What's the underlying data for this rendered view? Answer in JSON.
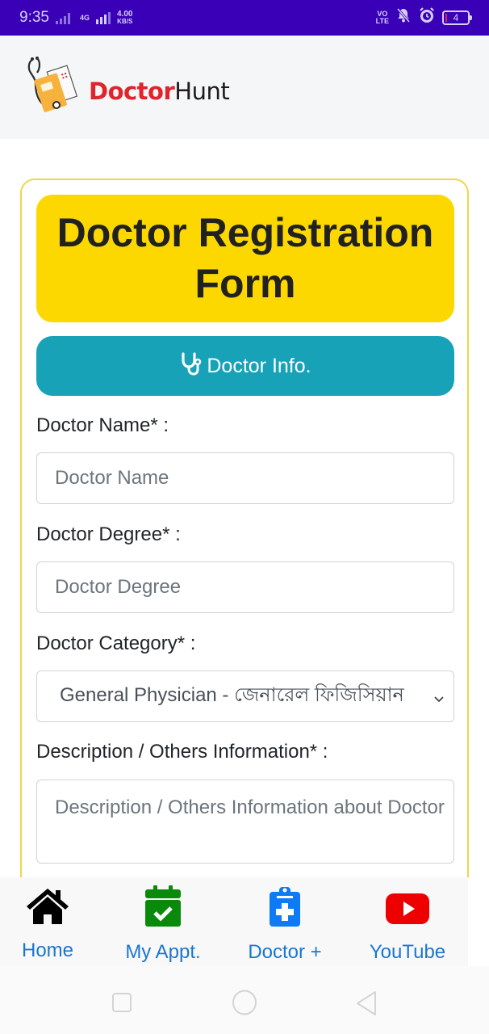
{
  "status_bar": {
    "time": "9:35",
    "network_type": "4G",
    "data_speed_value": "4.00",
    "data_speed_unit": "KB/S",
    "volte_top": "VO",
    "volte_bottom": "LTE",
    "battery_level": "4"
  },
  "header": {
    "brand_part1": "Doctor",
    "brand_part2": "Hunt"
  },
  "form": {
    "title": "Doctor Registration Form",
    "section_button": "Doctor Info.",
    "fields": [
      {
        "label": "Doctor Name* :",
        "placeholder": "Doctor Name"
      },
      {
        "label": "Doctor Degree* :",
        "placeholder": "Doctor Degree"
      },
      {
        "label": "Doctor Category* :",
        "selected": "General Physician - জেনারেল ফিজিসিয়ান"
      },
      {
        "label": "Description / Others Information* :",
        "placeholder": "Description / Others Information about Doctor"
      }
    ]
  },
  "bottom_nav": [
    {
      "label": "Home",
      "icon": "home-icon",
      "color": "#000000"
    },
    {
      "label": "My Appt.",
      "icon": "calendar-check-icon",
      "color": "#0a8a0a"
    },
    {
      "label": "Doctor +",
      "icon": "clipboard-medical-icon",
      "color": "#0d7bf5"
    },
    {
      "label": "YouTube",
      "icon": "youtube-icon",
      "color": "#ee0000"
    }
  ],
  "colors": {
    "status_bar": "#3a00b8",
    "title_bg": "#fdd800",
    "section_button_bg": "#17a2b8",
    "card_border": "#f1d54a",
    "nav_label": "#1976d2",
    "brand_red": "#e0242b"
  }
}
